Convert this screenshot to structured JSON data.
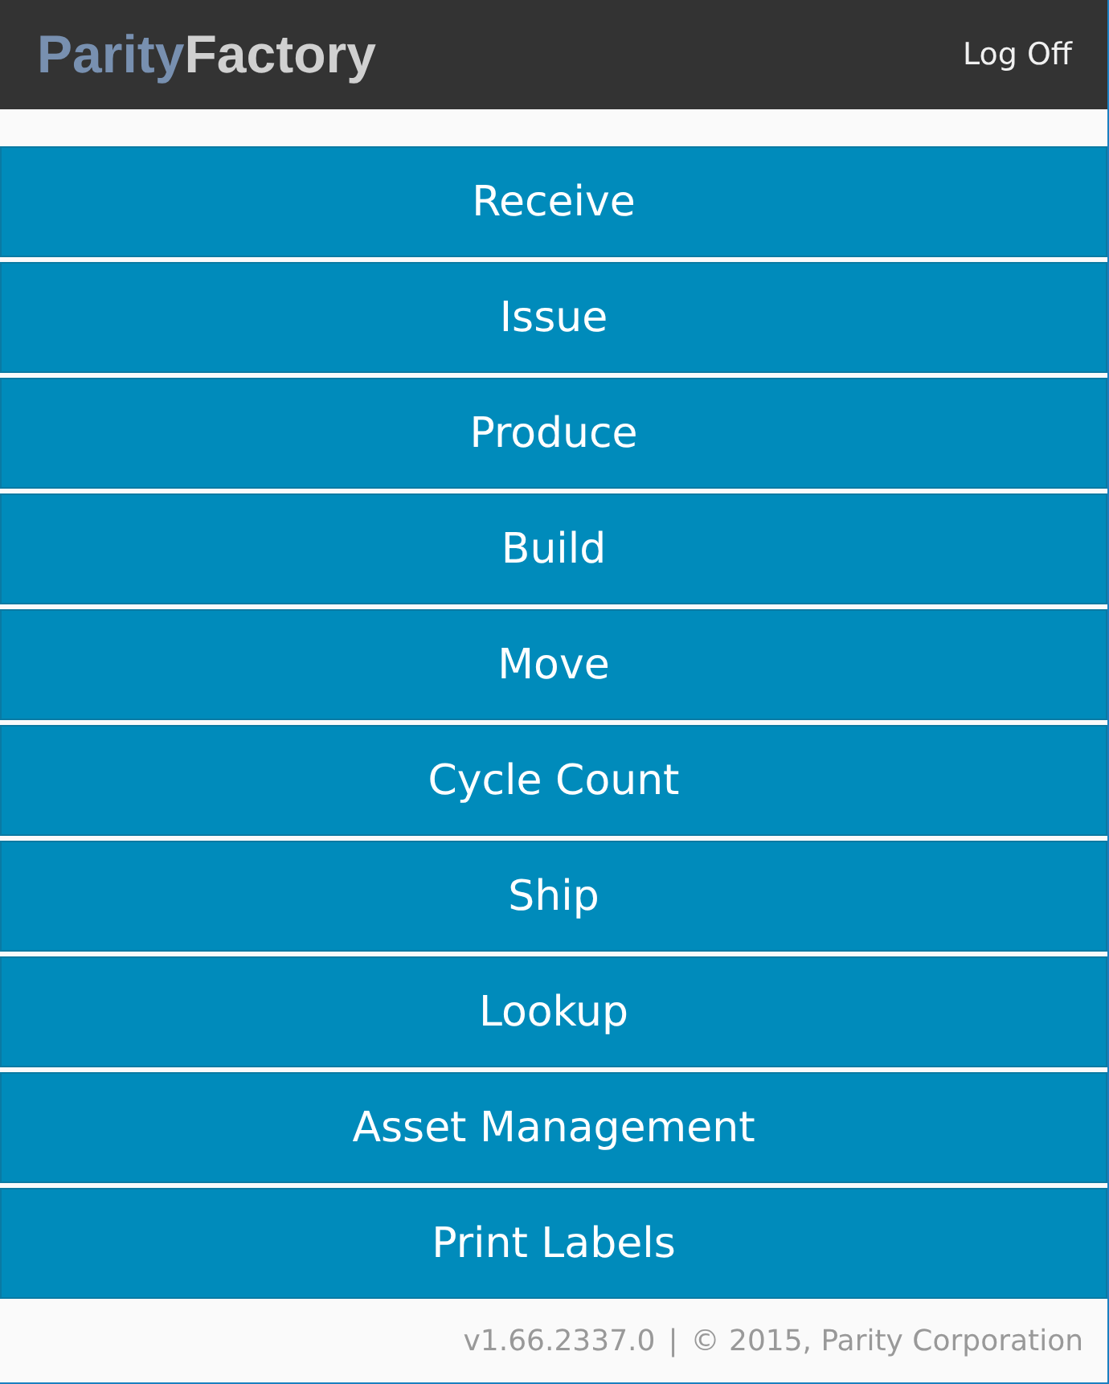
{
  "header": {
    "logo": [
      "Parity",
      "Factory"
    ],
    "logoff": "Log Off"
  },
  "menu": [
    "Receive",
    "Issue",
    "Produce",
    "Build",
    "Move",
    "Cycle Count",
    "Ship",
    "Lookup",
    "Asset Management",
    "Print Labels"
  ],
  "footer": {
    "version": "v1.66.2337.0",
    "separator": "|",
    "copyright": "© 2015, Parity Corporation"
  }
}
